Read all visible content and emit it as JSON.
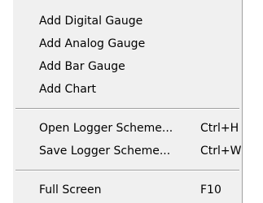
{
  "menu": {
    "items": [
      {
        "label": "Add Digital Gauge",
        "shortcut": ""
      },
      {
        "label": "Add Analog Gauge",
        "shortcut": ""
      },
      {
        "label": "Add Bar Gauge",
        "shortcut": ""
      },
      {
        "label": "Add Chart",
        "shortcut": ""
      },
      {
        "label": "Open Logger Scheme...",
        "shortcut": "Ctrl+H"
      },
      {
        "label": "Save Logger Scheme...",
        "shortcut": "Ctrl+W"
      },
      {
        "label": "Full Screen",
        "shortcut": "F10"
      }
    ]
  }
}
